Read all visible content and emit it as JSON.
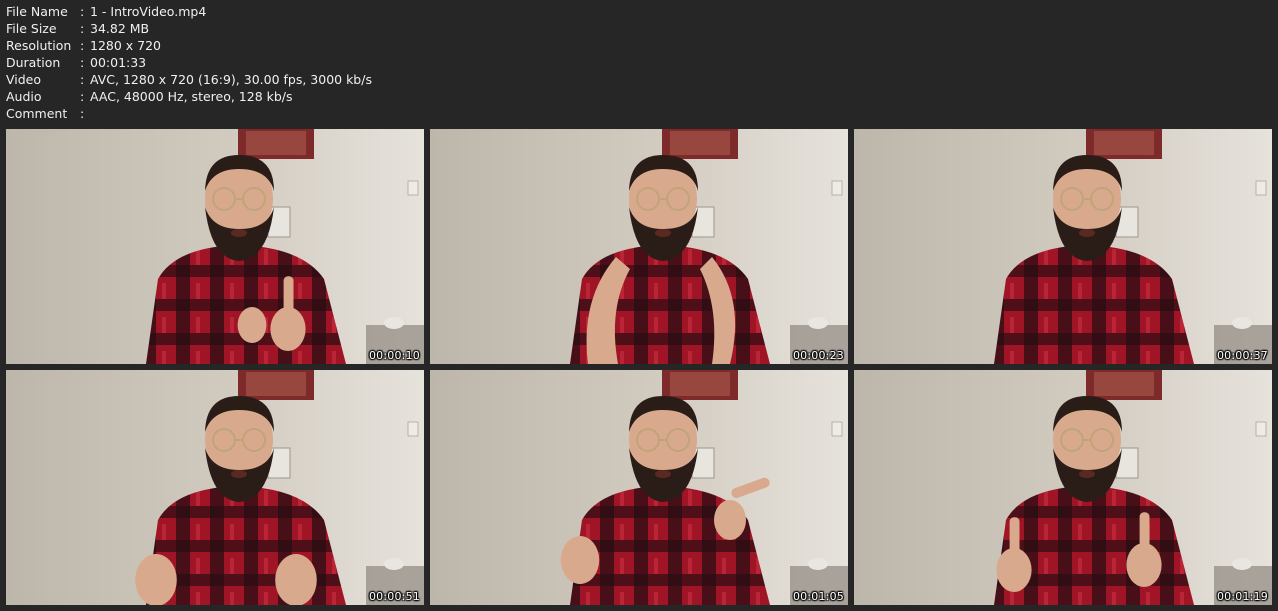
{
  "file_info": [
    {
      "label": "File Name",
      "value": "1 - IntroVideo.mp4"
    },
    {
      "label": "File Size",
      "value": "34.82 MB"
    },
    {
      "label": "Resolution",
      "value": "1280 x 720"
    },
    {
      "label": "Duration",
      "value": "00:01:33"
    },
    {
      "label": "Video",
      "value": "AVC, 1280 x 720 (16:9), 30.00 fps, 3000 kb/s"
    },
    {
      "label": "Audio",
      "value": "AAC, 48000 Hz, stereo, 128 kb/s"
    },
    {
      "label": "Comment",
      "value": ""
    }
  ],
  "separator": ":",
  "thumbnails": [
    {
      "timestamp": "00:00:10",
      "pose": "finger-up"
    },
    {
      "timestamp": "00:00:23",
      "pose": "hands-open"
    },
    {
      "timestamp": "00:00:37",
      "pose": "no-hands"
    },
    {
      "timestamp": "00:00:51",
      "pose": "hands-low"
    },
    {
      "timestamp": "00:01:05",
      "pose": "hands-gesture"
    },
    {
      "timestamp": "00:01:19",
      "pose": "fingers-up"
    }
  ],
  "colors": {
    "background": "#262626",
    "wall": "#cdc6bb",
    "shirt_red": "#a01526",
    "shirt_dark": "#2b0d12",
    "hair": "#2a1c16",
    "skin": "#d9a98d"
  }
}
